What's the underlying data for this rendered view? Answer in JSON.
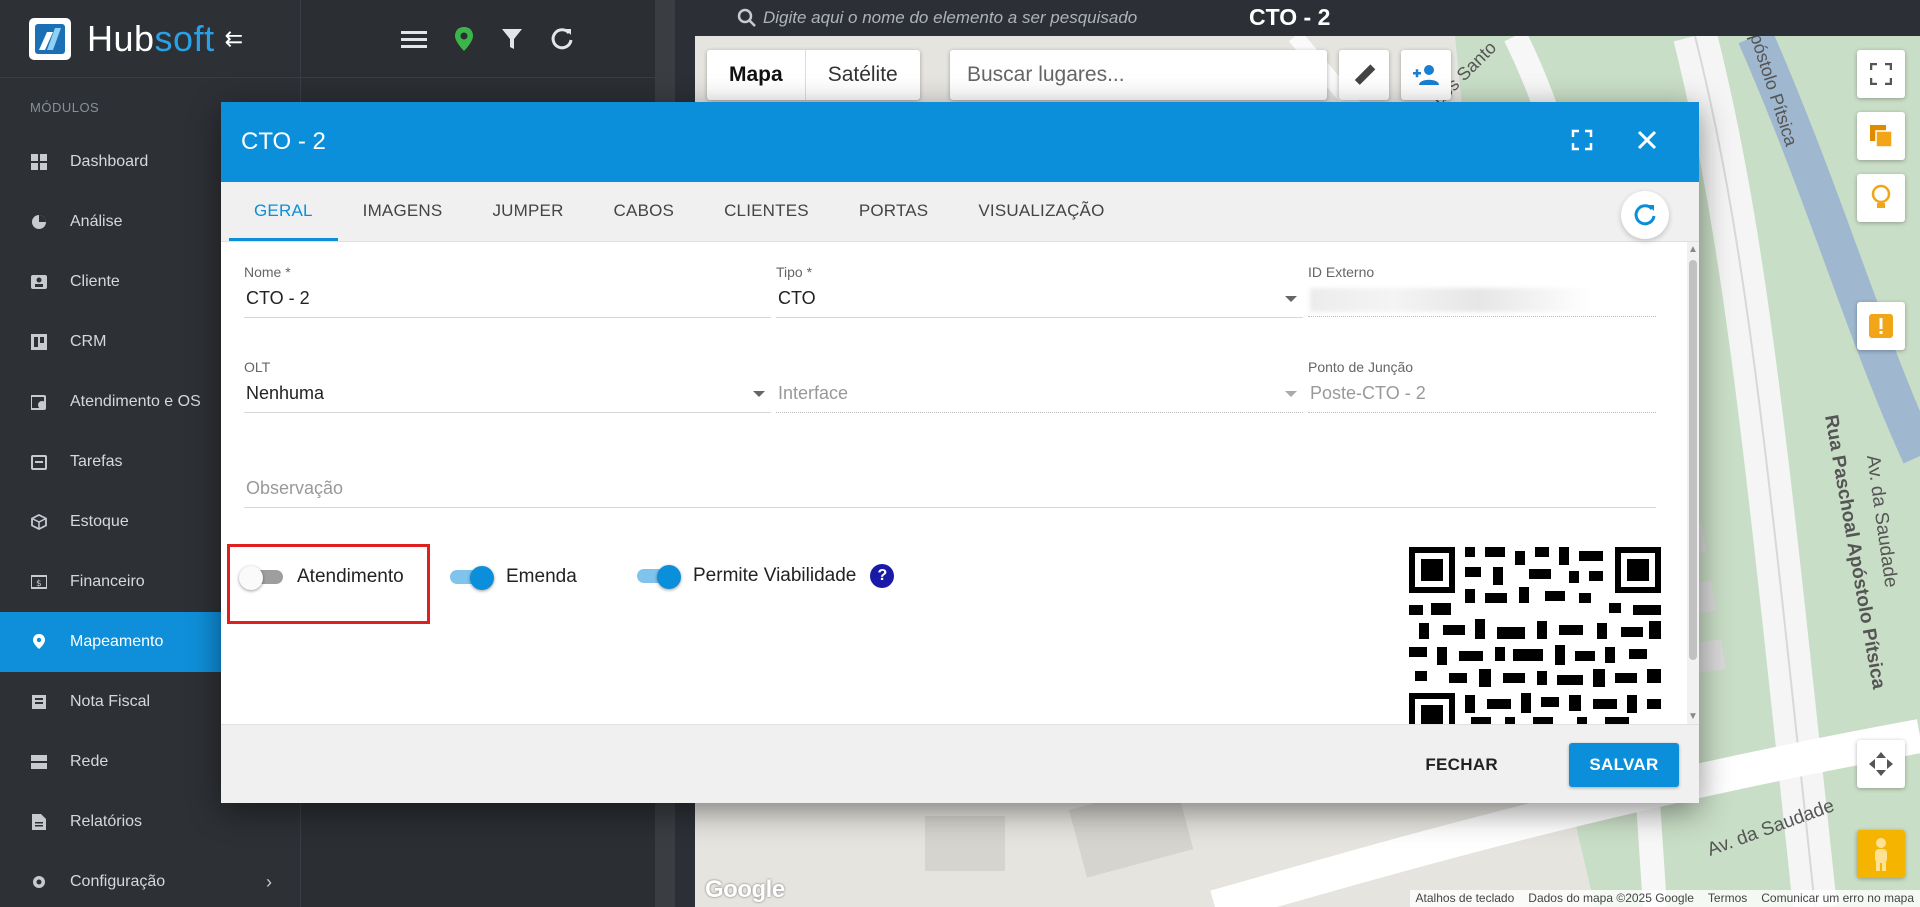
{
  "app": {
    "brand_hub": "Hub",
    "brand_soft": "soft"
  },
  "sidebar": {
    "modules_label": "MÓDULOS",
    "items": [
      {
        "label": "Dashboard",
        "icon": "dashboard-icon"
      },
      {
        "label": "Análise",
        "icon": "pie-chart-icon"
      },
      {
        "label": "Cliente",
        "icon": "contact-card-icon"
      },
      {
        "label": "CRM",
        "icon": "board-icon"
      },
      {
        "label": "Atendimento e OS",
        "icon": "calendar-clock-icon"
      },
      {
        "label": "Tarefas",
        "icon": "calendar-check-icon"
      },
      {
        "label": "Estoque",
        "icon": "box-icon"
      },
      {
        "label": "Financeiro",
        "icon": "money-icon"
      },
      {
        "label": "Mapeamento",
        "icon": "map-pin-icon",
        "active": true
      },
      {
        "label": "Nota Fiscal",
        "icon": "invoice-icon"
      },
      {
        "label": "Rede",
        "icon": "server-icon"
      },
      {
        "label": "Relatórios",
        "icon": "report-icon"
      },
      {
        "label": "Configuração",
        "icon": "gear-icon",
        "has_submenu": true
      }
    ]
  },
  "map": {
    "search_placeholder": "Digite aqui o nome do elemento a ser pesquisado",
    "title": "CTO - 2",
    "type_map": "Mapa",
    "type_satellite": "Satélite",
    "places_placeholder": "Buscar lugares...",
    "google": "Google",
    "footer": [
      "Atalhos de teclado",
      "Dados do mapa ©2025 Google",
      "Termos",
      "Comunicar um erro no mapa"
    ],
    "street_labels": [
      "Rua Paschoal Apóstolo Pítsica",
      "Av. da Saudade",
      "dos Santo",
      "póstolo Pítsica",
      "Av. da Saudade"
    ]
  },
  "modal": {
    "title": "CTO - 2",
    "tabs": [
      "GERAL",
      "IMAGENS",
      "JUMPER",
      "CABOS",
      "CLIENTES",
      "PORTAS",
      "VISUALIZAÇÃO"
    ],
    "fields": {
      "nome_label": "Nome *",
      "nome_value": "CTO - 2",
      "tipo_label": "Tipo *",
      "tipo_value": "CTO",
      "id_externo_label": "ID Externo",
      "olt_label": "OLT",
      "olt_value": "Nenhuma",
      "interface_placeholder": "Interface",
      "ponto_label": "Ponto de Junção",
      "ponto_value": "Poste-CTO - 2",
      "observacao_placeholder": "Observação"
    },
    "toggles": {
      "atendimento": {
        "label": "Atendimento",
        "on": false
      },
      "emenda": {
        "label": "Emenda",
        "on": true
      },
      "viabilidade": {
        "label": "Permite Viabilidade",
        "on": true
      }
    },
    "help": "?",
    "btn_close": "FECHAR",
    "btn_save": "SALVAR"
  },
  "colors": {
    "accent": "#0b8fdb",
    "sidebar_bg": "#2d3035",
    "highlight": "#e01f1f"
  }
}
